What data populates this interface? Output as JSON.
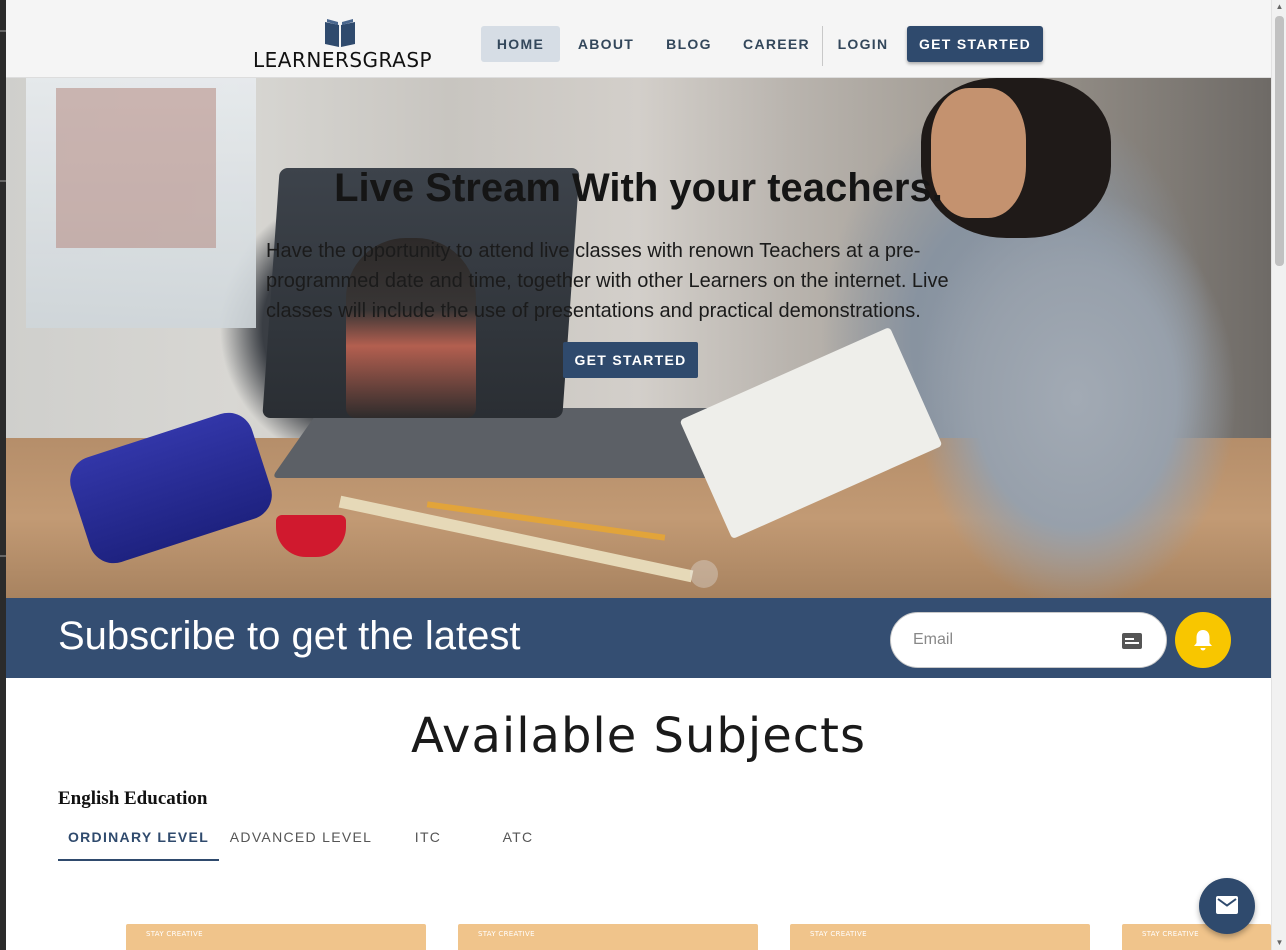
{
  "header": {
    "logo_text": "LEARNERSGRASP",
    "nav": {
      "home": "HOME",
      "about": "ABOUT",
      "blog": "BLOG",
      "career": "CAREER",
      "login": "LOGIN",
      "get_started": "GET STARTED"
    }
  },
  "hero": {
    "title": "Live Stream With your teachers.",
    "description": "Have the opportunity to attend live classes with renown Teachers at a pre-programmed date and time, together with other Learners on the internet. Live classes will include the use of presentations and practical demonstrations.",
    "cta": "GET STARTED"
  },
  "subscribe": {
    "title": "Subscribe to get the latest",
    "email_placeholder": "Email",
    "email_value": ""
  },
  "subjects": {
    "title": "Available Subjects",
    "category": "English Education",
    "tabs": [
      "ORDINARY LEVEL",
      "ADVANCED LEVEL",
      "ITC",
      "ATC"
    ],
    "active_tab": "ORDINARY LEVEL",
    "cards": [
      {
        "label": "STAY CREATIVE"
      },
      {
        "label": "STAY CREATIVE"
      },
      {
        "label": "STAY CREATIVE"
      },
      {
        "label": "STAY CREATIVE"
      }
    ]
  },
  "icons": {
    "logo": "open-book-icon",
    "email": "id-card-icon",
    "subscribe_button": "bell-icon",
    "fab": "mail-icon"
  },
  "colors": {
    "primary": "#2f4a6d",
    "subscribe_bar": "#344e72",
    "bell_button": "#f8c600",
    "card": "#f0c48b",
    "active_nav_bg": "#d6dde5"
  }
}
